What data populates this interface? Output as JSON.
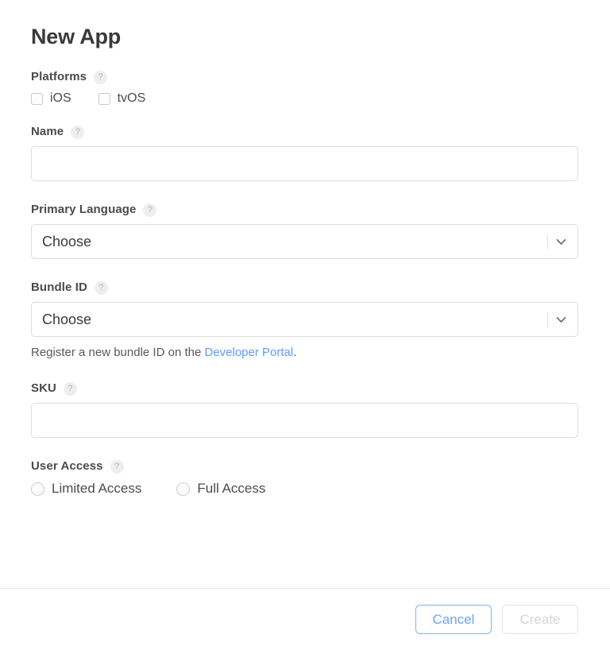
{
  "dialog": {
    "title": "New App"
  },
  "fields": {
    "platforms": {
      "label": "Platforms",
      "help": "?",
      "options": [
        {
          "label": "iOS",
          "checked": false
        },
        {
          "label": "tvOS",
          "checked": false
        }
      ]
    },
    "name": {
      "label": "Name",
      "help": "?",
      "value": "",
      "placeholder": ""
    },
    "primary_language": {
      "label": "Primary Language",
      "help": "?",
      "value": "Choose"
    },
    "bundle_id": {
      "label": "Bundle ID",
      "help": "?",
      "value": "Choose",
      "helper_prefix": "Register a new bundle ID on the ",
      "helper_link": "Developer Portal",
      "helper_suffix": "."
    },
    "sku": {
      "label": "SKU",
      "help": "?",
      "value": "",
      "placeholder": ""
    },
    "user_access": {
      "label": "User Access",
      "help": "?",
      "options": [
        {
          "label": "Limited Access",
          "selected": false
        },
        {
          "label": "Full Access",
          "selected": false
        }
      ]
    }
  },
  "footer": {
    "cancel_label": "Cancel",
    "create_label": "Create",
    "create_disabled": true
  },
  "colors": {
    "link": "#5e9cf5",
    "cancel_border": "#7eb0f7",
    "cancel_text": "#6ba4f8",
    "disabled_text": "#d6d6d8",
    "label_text": "#4a4a4d",
    "border": "#dcdcde"
  }
}
